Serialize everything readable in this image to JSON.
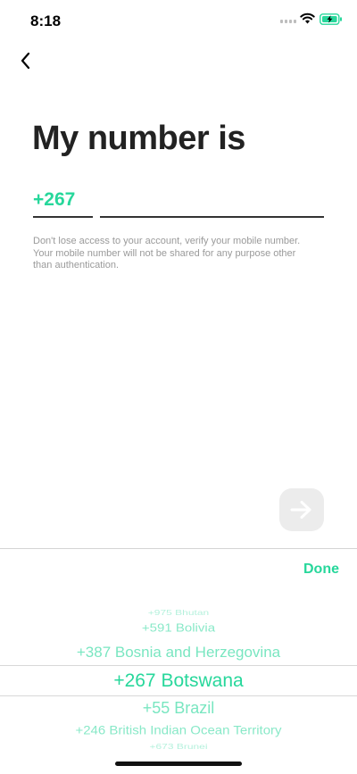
{
  "status_bar": {
    "time": "8:18",
    "battery_color": "#27d79b"
  },
  "header": {
    "back_icon": "chevron-left-icon"
  },
  "title": "My number is",
  "phone": {
    "country_code": "+267",
    "number_value": "",
    "number_placeholder": ""
  },
  "helper_text": {
    "line1": "Don't lose access to your account, verify your mobile number.",
    "line2": "Your mobile number will not be shared for any purpose other than authentication."
  },
  "next_button": {
    "icon": "arrow-right-icon"
  },
  "picker": {
    "done_label": "Done",
    "accent_color": "#27d79b",
    "options": [
      {
        "label": "+975 Bhutan"
      },
      {
        "label": "+591 Bolivia"
      },
      {
        "label": "+387 Bosnia and Herzegovina"
      },
      {
        "label": "+267 Botswana",
        "selected": true
      },
      {
        "label": "+55 Brazil"
      },
      {
        "label": "+246 British Indian Ocean Territory"
      },
      {
        "label": "+673 Brunei"
      }
    ]
  }
}
